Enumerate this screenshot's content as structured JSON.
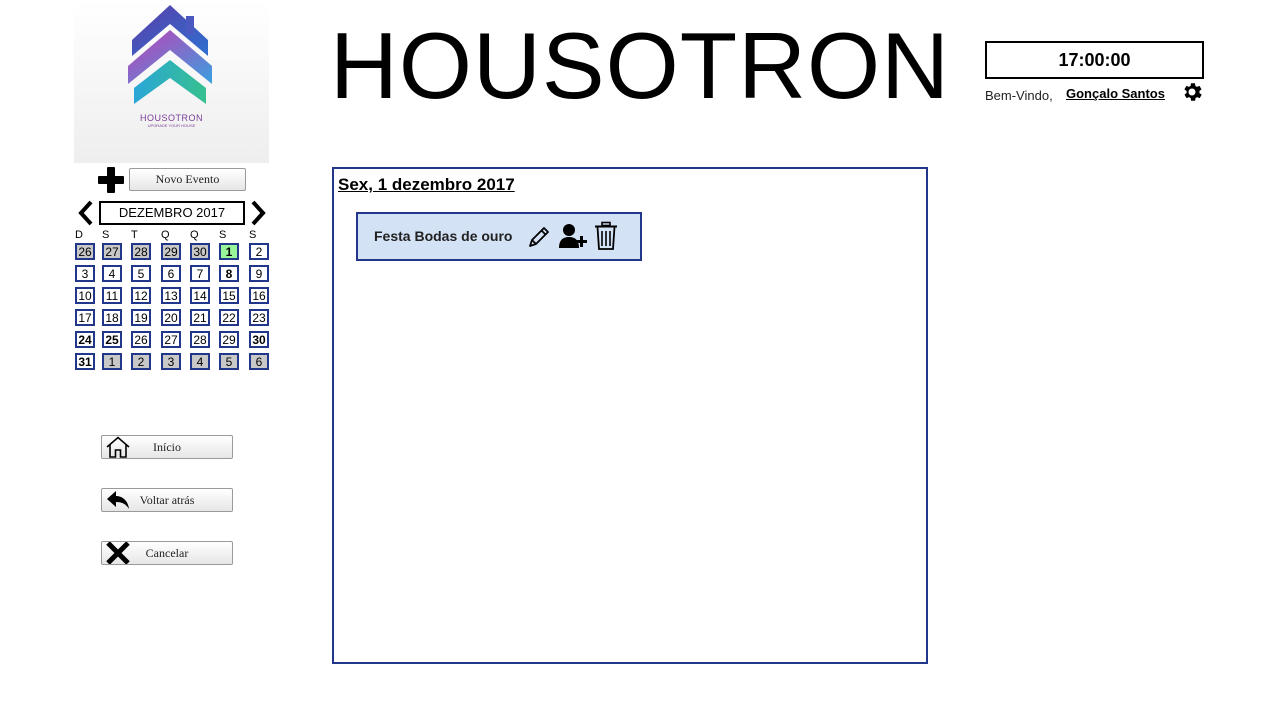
{
  "app": {
    "title": "HOUSOTRON",
    "logo_text": "HOUSOTRON",
    "logo_tagline": "UPGRADE YOUR HOUSE"
  },
  "header": {
    "clock": "17:00:00",
    "welcome": "Bem-Vindo,",
    "user_name": "Gonçalo Santos",
    "settings_icon": "gear-icon"
  },
  "sidebar": {
    "new_event_label": "Novo Evento",
    "month_label": "DEZEMBRO 2017",
    "weekdays": [
      "D",
      "S",
      "T",
      "Q",
      "Q",
      "S",
      "S"
    ],
    "weeks": [
      [
        {
          "n": "26",
          "t": "other"
        },
        {
          "n": "27",
          "t": "other"
        },
        {
          "n": "28",
          "t": "other"
        },
        {
          "n": "29",
          "t": "other"
        },
        {
          "n": "30",
          "t": "other"
        },
        {
          "n": "1",
          "t": "selected"
        },
        {
          "n": "2",
          "t": ""
        }
      ],
      [
        {
          "n": "3",
          "t": ""
        },
        {
          "n": "4",
          "t": ""
        },
        {
          "n": "5",
          "t": ""
        },
        {
          "n": "6",
          "t": ""
        },
        {
          "n": "7",
          "t": ""
        },
        {
          "n": "8",
          "t": "bold"
        },
        {
          "n": "9",
          "t": ""
        }
      ],
      [
        {
          "n": "10",
          "t": ""
        },
        {
          "n": "11",
          "t": ""
        },
        {
          "n": "12",
          "t": ""
        },
        {
          "n": "13",
          "t": ""
        },
        {
          "n": "14",
          "t": ""
        },
        {
          "n": "15",
          "t": ""
        },
        {
          "n": "16",
          "t": ""
        }
      ],
      [
        {
          "n": "17",
          "t": ""
        },
        {
          "n": "18",
          "t": ""
        },
        {
          "n": "19",
          "t": ""
        },
        {
          "n": "20",
          "t": ""
        },
        {
          "n": "21",
          "t": ""
        },
        {
          "n": "22",
          "t": ""
        },
        {
          "n": "23",
          "t": ""
        }
      ],
      [
        {
          "n": "24",
          "t": "bold"
        },
        {
          "n": "25",
          "t": "bold"
        },
        {
          "n": "26",
          "t": ""
        },
        {
          "n": "27",
          "t": ""
        },
        {
          "n": "28",
          "t": ""
        },
        {
          "n": "29",
          "t": ""
        },
        {
          "n": "30",
          "t": "bold"
        }
      ],
      [
        {
          "n": "31",
          "t": "bold"
        },
        {
          "n": "1",
          "t": "other"
        },
        {
          "n": "2",
          "t": "other"
        },
        {
          "n": "3",
          "t": "other"
        },
        {
          "n": "4",
          "t": "other"
        },
        {
          "n": "5",
          "t": "other"
        },
        {
          "n": "6",
          "t": "other"
        }
      ]
    ],
    "nav": {
      "home_label": "Início",
      "back_label": "Voltar atrás",
      "cancel_label": "Cancelar"
    }
  },
  "main": {
    "date_heading": "Sex, 1 dezembro 2017",
    "events": [
      {
        "name": "Festa Bodas de ouro",
        "actions": [
          "pencil-icon",
          "add-user-icon",
          "trash-icon"
        ]
      }
    ]
  },
  "colors": {
    "accent_border": "#23378a",
    "selected_day": "#99f59a",
    "other_month_day": "#c8c8c8",
    "event_bg": "#d3e2f5"
  }
}
